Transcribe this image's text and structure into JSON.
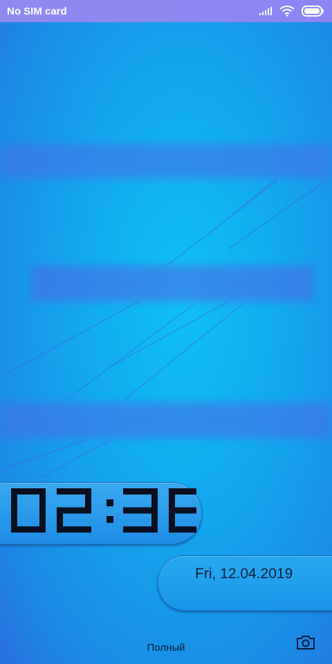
{
  "status_bar": {
    "carrier": "No SIM card",
    "icons": [
      "signal-icon",
      "wifi-icon",
      "battery-icon"
    ]
  },
  "clock": {
    "time": "02:36"
  },
  "date": {
    "text": "Fri, 12.04.2019"
  },
  "footer": {
    "label": "Полный"
  },
  "shortcuts": {
    "camera_icon": "camera-icon"
  },
  "colors": {
    "background": "#12a9ef",
    "status_bar": "#8f8af0",
    "digits": "#0a1020"
  }
}
